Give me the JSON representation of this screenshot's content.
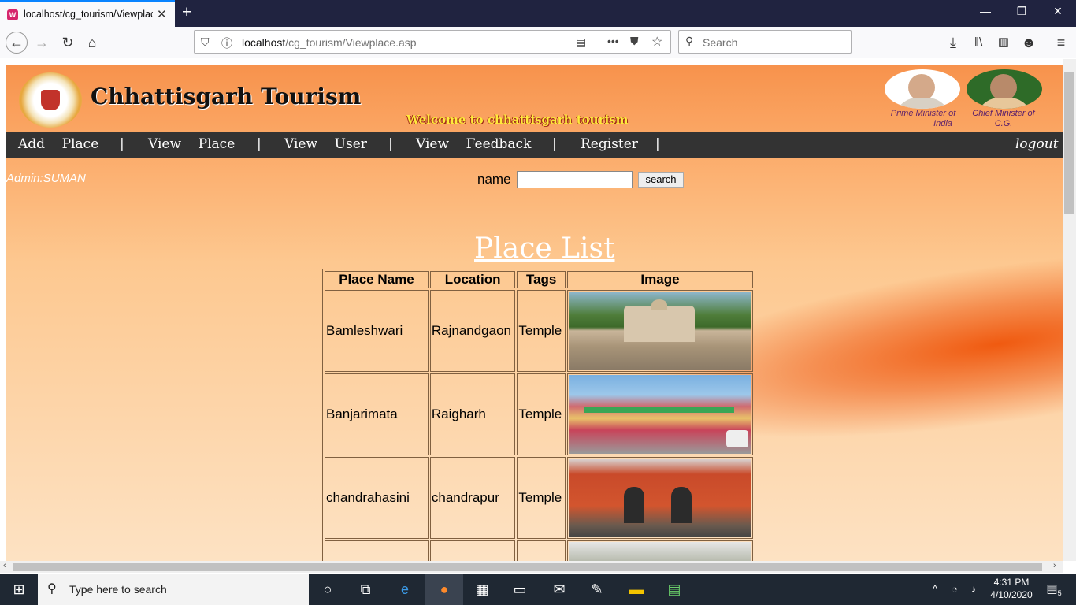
{
  "browser": {
    "tab_title": "localhost/cg_tourism/Viewplac",
    "url_host": "localhost",
    "url_path": "/cg_tourism/Viewplace.asp",
    "search_placeholder": "Search"
  },
  "site": {
    "name": "Chhattisgarh Tourism",
    "welcome": "Welcome to chhattisgarh tourism",
    "pm_caption_1": "Prime Minister of",
    "pm_caption_2": "India",
    "cm_caption_1": "Chief Minister of",
    "cm_caption_2": "C.G."
  },
  "menu": {
    "add": "Add",
    "place1": "Place",
    "sep": "|",
    "view1": "View",
    "place2": "Place",
    "view2": "View",
    "user": "User",
    "view3": "View",
    "feedback": "Feedback",
    "register": "Register",
    "logout": "logout"
  },
  "admin_label": "Admin:SUMAN",
  "search": {
    "label": "name",
    "value": "",
    "button": "search"
  },
  "page_title": "Place List",
  "table": {
    "headers": [
      "Place Name",
      "Location",
      "Tags",
      "Image"
    ],
    "rows": [
      {
        "name": "Bamleshwari",
        "location": "Rajnandgaon",
        "tag": "Temple"
      },
      {
        "name": "Banjarimata",
        "location": "Raigharh",
        "tag": "Temple"
      },
      {
        "name": "chandrahasini",
        "location": "chandrapur",
        "tag": "Temple"
      },
      {
        "name": "",
        "location": "",
        "tag": ""
      }
    ]
  },
  "taskbar": {
    "search_placeholder": "Type here to search",
    "time": "4:31 PM",
    "date": "4/10/2020",
    "notif_count": "5"
  }
}
